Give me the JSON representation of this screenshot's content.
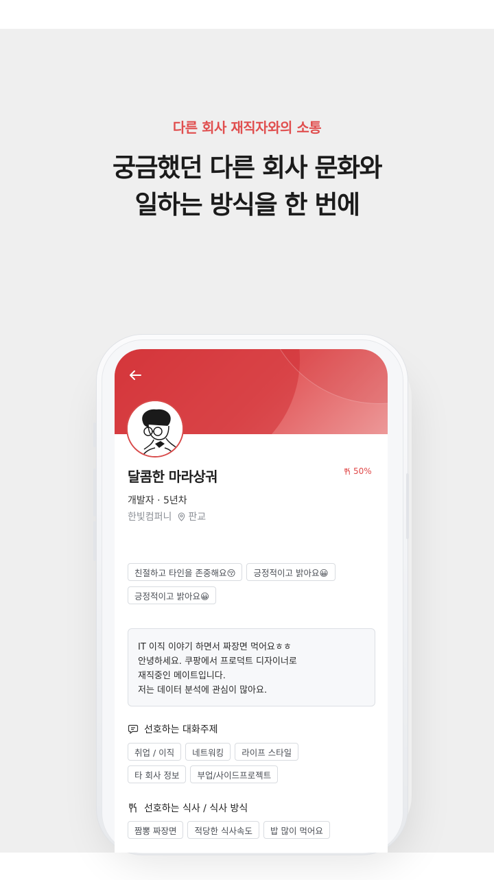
{
  "hero": {
    "subtitle": "다른 회사 재직자와의 소통",
    "title_line1": "궁금했던 다른 회사 문화와",
    "title_line2": "일하는 방식을 한 번에"
  },
  "profile": {
    "name": "달콤한 마라상궈",
    "match_rate": "50%",
    "role": "개발자 · 5년차",
    "company": "한빛컴퍼니",
    "location": "판교",
    "personality_tags": [
      "친절하고 타인을 존중해요😚",
      "긍정적이고 밝아요😀",
      "긍정적이고 밝아요😀"
    ],
    "bio_lines": [
      "IT 이직 이야기 하면서 짜장면 먹어요ㅎㅎ",
      "안녕하세요. 쿠팡에서 프로덕트 디자이너로",
      "재직중인 메이트입니다.",
      "저는 데이터 분석에 관심이 많아요."
    ]
  },
  "sections": {
    "topics_title": "선호하는 대화주제",
    "topics": [
      "취업 / 이직",
      "네트워킹",
      "라이프 스타일",
      "타 회사 정보",
      "부업/사이드프로젝트"
    ],
    "meal_title": "선호하는 식사 / 식사 방식",
    "meals": [
      "짬뽕 짜장면",
      "적당한 식사속도",
      "밥 많이 먹어요"
    ]
  },
  "colors": {
    "accent": "#e04e4e",
    "banner": "#d83c40"
  },
  "icons": [
    "back-arrow-icon",
    "utensils-icon",
    "location-pin-icon",
    "chat-bubble-icon"
  ]
}
